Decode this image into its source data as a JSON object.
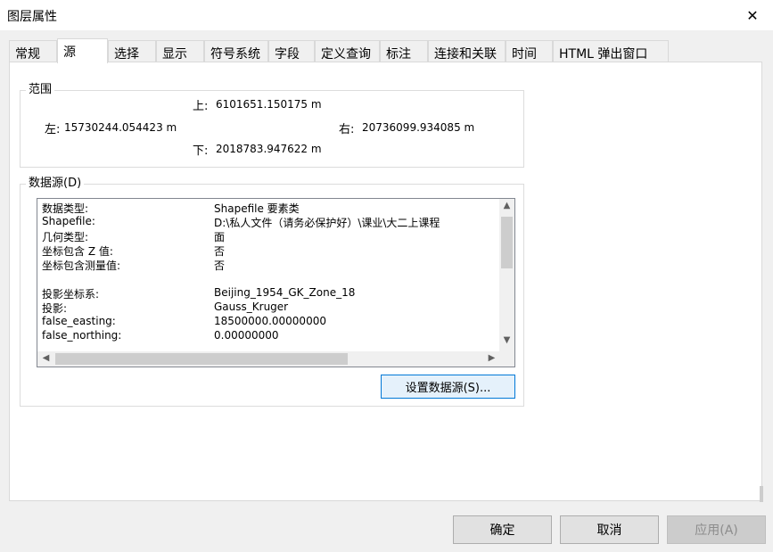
{
  "window": {
    "title": "图层属性",
    "close_glyph": "✕"
  },
  "tabs": [
    {
      "label": "常规"
    },
    {
      "label": "源"
    },
    {
      "label": "选择"
    },
    {
      "label": "显示"
    },
    {
      "label": "符号系统"
    },
    {
      "label": "字段"
    },
    {
      "label": "定义查询"
    },
    {
      "label": "标注"
    },
    {
      "label": "连接和关联"
    },
    {
      "label": "时间"
    },
    {
      "label": "HTML 弹出窗口"
    }
  ],
  "active_tab": "源",
  "extent": {
    "title": "范围",
    "top_label": "上:",
    "top_value": "6101651.150175 m",
    "left_label": "左:",
    "left_value": "15730244.054423 m",
    "right_label": "右:",
    "right_value": "20736099.934085 m",
    "bottom_label": "下:",
    "bottom_value": "2018783.947622 m"
  },
  "datasource": {
    "title": "数据源(D)",
    "rows": [
      {
        "key": "数据类型:",
        "value": "Shapefile 要素类"
      },
      {
        "key": "Shapefile:",
        "value": "D:\\私人文件（请务必保护好）\\课业\\大二上课程"
      },
      {
        "key": "几何类型:",
        "value": "面"
      },
      {
        "key": "坐标包含 Z 值:",
        "value": "否"
      },
      {
        "key": "坐标包含测量值:",
        "value": "否"
      },
      {
        "key": "",
        "value": ""
      },
      {
        "key": "投影坐标系:",
        "value": "Beijing_1954_GK_Zone_18"
      },
      {
        "key": "投影:",
        "value": "Gauss_Kruger"
      },
      {
        "key": "false_easting:",
        "value": "18500000.00000000"
      },
      {
        "key": "false_northing:",
        "value": "0.00000000"
      }
    ],
    "set_button": "设置数据源(S)..."
  },
  "buttons": {
    "ok": "确定",
    "cancel": "取消",
    "apply": "应用(A)"
  },
  "icons": {
    "scroll_up": "▲",
    "scroll_down": "▼",
    "scroll_left": "◀",
    "scroll_right": "▶"
  }
}
